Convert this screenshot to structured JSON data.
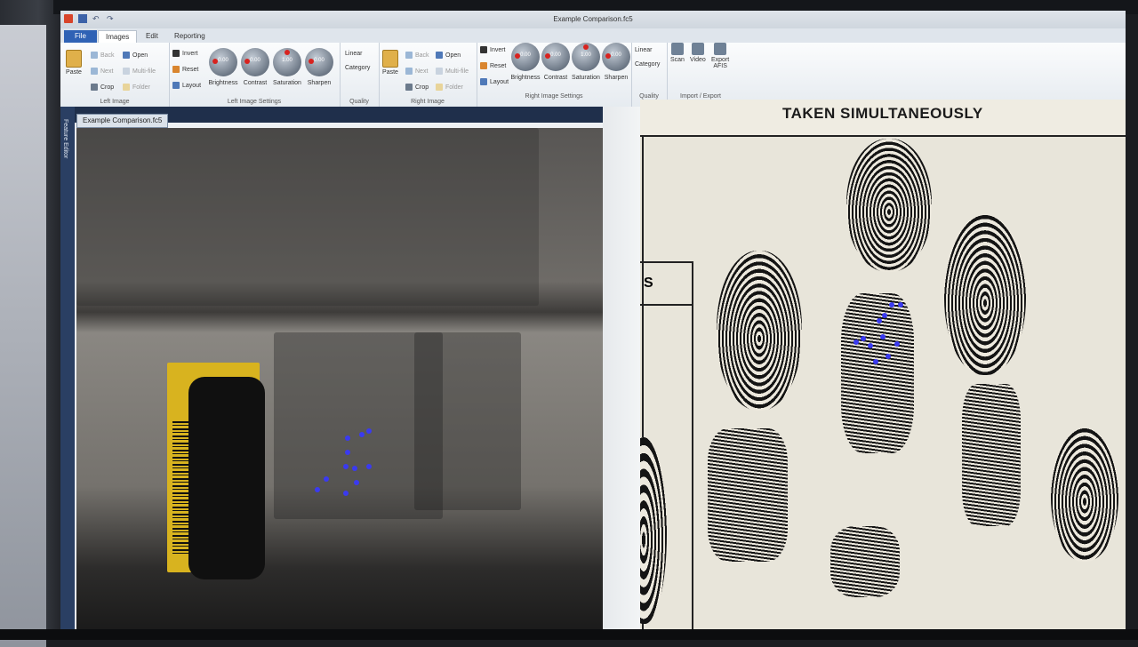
{
  "window": {
    "title": "Example Comparison.fc5"
  },
  "menu_tabs": {
    "file": "File",
    "images": "Images",
    "edit": "Edit",
    "reporting": "Reporting"
  },
  "left_image": {
    "paste": "Paste",
    "back": "Back",
    "next": "Next",
    "crop": "Crop",
    "open": "Open",
    "multi_file": "Multi-file",
    "folder": "Folder",
    "group_label": "Left Image",
    "invert": "Invert",
    "reset": "Reset",
    "layout": "Layout",
    "knobs": [
      {
        "value": "0.00",
        "label": "Brightness"
      },
      {
        "value": "0.00",
        "label": "Contrast"
      },
      {
        "value": "1.00",
        "label": "Saturation"
      },
      {
        "value": "0.00",
        "label": "Sharpen"
      }
    ],
    "settings_label": "Left Image Settings"
  },
  "quality_left": {
    "linear": "Linear",
    "category": "Category",
    "label": "Quality"
  },
  "right_image": {
    "paste": "Paste",
    "back": "Back",
    "next": "Next",
    "crop": "Crop",
    "open": "Open",
    "multi_file": "Multi-file",
    "folder": "Folder",
    "group_label": "Right Image",
    "invert": "Invert",
    "reset": "Reset",
    "layout": "Layout",
    "knobs": [
      {
        "value": "0.00",
        "label": "Brightness"
      },
      {
        "value": "0.00",
        "label": "Contrast"
      },
      {
        "value": "1.00",
        "label": "Saturation"
      },
      {
        "value": "0.00",
        "label": "Sharpen"
      }
    ],
    "settings_label": "Right Image Settings"
  },
  "quality_right": {
    "linear": "Linear",
    "category": "Category",
    "label": "Quality"
  },
  "import_export": {
    "scan": "Scan",
    "video": "Video",
    "export": "Export",
    "afis": "AFIS",
    "label": "Import / Export"
  },
  "document_tab": "Example Comparison.fc5",
  "side_panel": "Feature Editor",
  "card": {
    "header": "TAKEN SIMULTANEOUSLY",
    "box_letter": "S"
  }
}
